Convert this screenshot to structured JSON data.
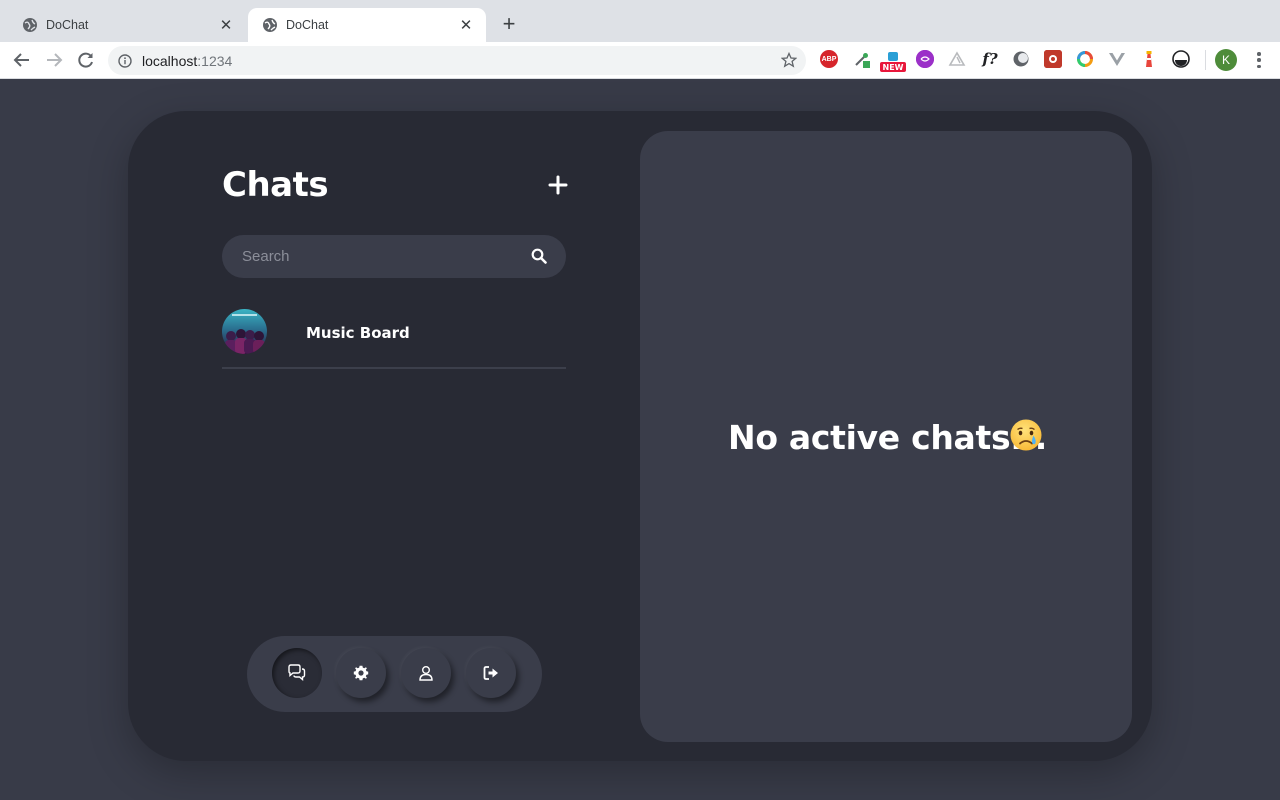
{
  "browser": {
    "tabs": [
      {
        "title": "DoChat",
        "active": false
      },
      {
        "title": "DoChat",
        "active": true
      }
    ],
    "url_host": "localhost",
    "url_port": ":1234",
    "extensions": [
      {
        "name": "adblock-plus-extension-icon",
        "label": "ABP",
        "color": "#d6252b"
      },
      {
        "name": "eyedropper-extension-icon",
        "color": "#3aa757"
      },
      {
        "name": "new-badge-extension-icon",
        "label": "NEW",
        "color": "#e8173b"
      },
      {
        "name": "purple-extension-icon",
        "color": "#9b30c8"
      },
      {
        "name": "triangle-extension-icon",
        "color": "#b8babd"
      },
      {
        "name": "fonts-extension-icon",
        "label": "f?",
        "color": "#202124"
      },
      {
        "name": "moon-extension-icon",
        "color": "#5f6368"
      },
      {
        "name": "red-square-extension-icon",
        "color": "#c0392b"
      },
      {
        "name": "ring-extension-icon",
        "color": "#f39c12"
      },
      {
        "name": "vue-extension-icon",
        "color": "#9aa0a6"
      },
      {
        "name": "lighthouse-extension-icon",
        "color": "#e8453c"
      },
      {
        "name": "dark-circle-extension-icon",
        "color": "#202124"
      }
    ],
    "profile_initial": "K",
    "profile_color": "#4e8c3a"
  },
  "sidebar": {
    "title": "Chats",
    "search_placeholder": "Search",
    "chats": [
      {
        "name": "Music Board"
      }
    ],
    "nav": [
      {
        "name": "chats",
        "active": true
      },
      {
        "name": "settings",
        "active": false
      },
      {
        "name": "profile",
        "active": false
      },
      {
        "name": "logout",
        "active": false
      }
    ]
  },
  "main": {
    "empty_text": "No active chats...",
    "empty_emoji": "crying-face"
  },
  "colors": {
    "page_bg": "#383b48",
    "frame_bg": "#282a34",
    "panel_bg": "#3a3d4a",
    "text": "#ffffff"
  }
}
